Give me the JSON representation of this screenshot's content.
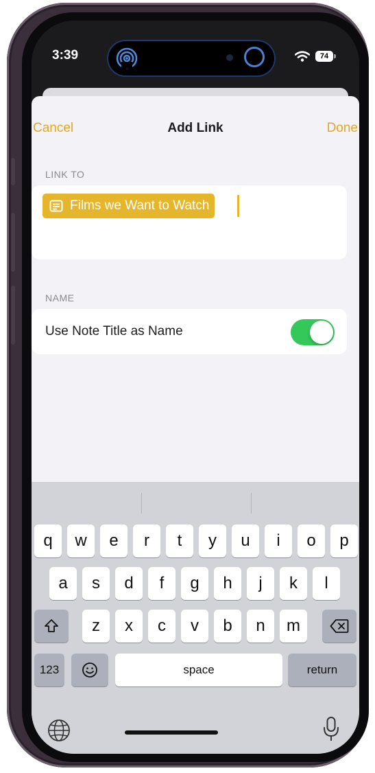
{
  "status_bar": {
    "time": "3:39",
    "battery": "74"
  },
  "nav": {
    "cancel": "Cancel",
    "title": "Add Link",
    "done": "Done"
  },
  "link_section": {
    "label": "LINK TO",
    "chip_text": "Films we Want to Watch"
  },
  "name_section": {
    "label": "NAME",
    "toggle_label": "Use Note Title as Name",
    "toggle_on": true
  },
  "keyboard": {
    "row1": [
      "q",
      "w",
      "e",
      "r",
      "t",
      "y",
      "u",
      "i",
      "o",
      "p"
    ],
    "row2": [
      "a",
      "s",
      "d",
      "f",
      "g",
      "h",
      "j",
      "k",
      "l"
    ],
    "row3": [
      "z",
      "x",
      "c",
      "v",
      "b",
      "n",
      "m"
    ],
    "numbers_key": "123",
    "space_key": "space",
    "return_key": "return"
  },
  "colors": {
    "accent": "#e0a826",
    "chip": "#e5b52b",
    "toggle_on": "#34c759"
  },
  "icons": [
    "airdrop-icon",
    "wifi-icon",
    "battery-icon",
    "note-icon",
    "shift-icon",
    "delete-icon",
    "emoji-icon",
    "globe-icon",
    "mic-icon"
  ]
}
